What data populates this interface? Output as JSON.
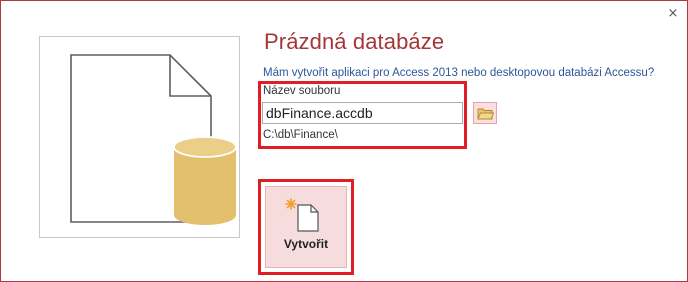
{
  "dialog": {
    "title": "Prázdná databáze",
    "question_link": "Mám vytvořit aplikaci pro Access 2013 nebo desktopovou databázi Accessu?",
    "close_glyph": "×"
  },
  "file": {
    "label": "Název souboru",
    "value": "dbFinance.accdb",
    "path": "C:\\db\\Finance\\"
  },
  "buttons": {
    "browse_icon": "folder-icon",
    "create_label": "Vytvořit",
    "create_icon": "new-document-icon"
  },
  "colors": {
    "title": "#a4373a",
    "link": "#2b579a",
    "highlight": "#e01e25",
    "button_bg": "#f6dcdd",
    "database": "#e2c06e"
  }
}
